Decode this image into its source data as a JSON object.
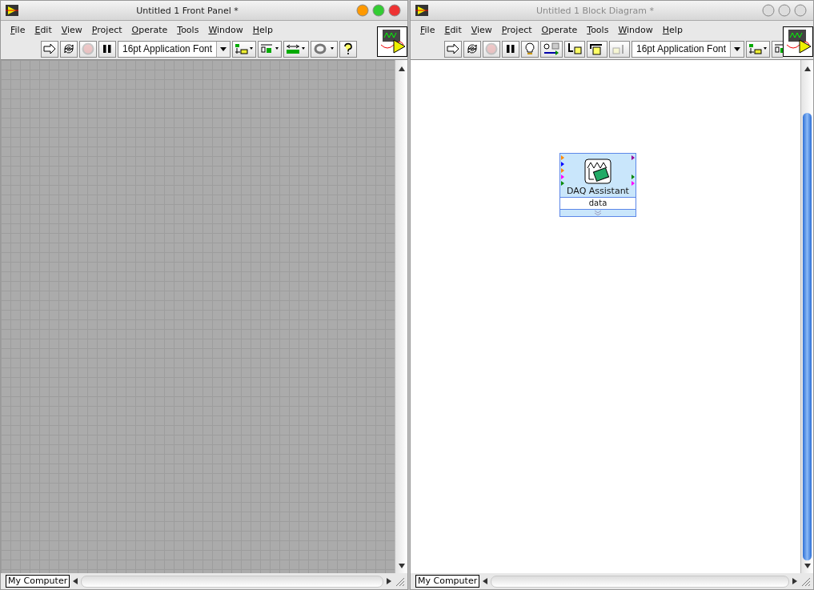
{
  "windows": [
    {
      "title": "Untitled 1 Front Panel *",
      "active": true,
      "menu": [
        "File",
        "Edit",
        "View",
        "Project",
        "Operate",
        "Tools",
        "Window",
        "Help"
      ],
      "toolbar": [
        {
          "kind": "run",
          "disabled": false
        },
        {
          "kind": "run-continuous",
          "disabled": false
        },
        {
          "kind": "abort",
          "disabled": true
        },
        {
          "kind": "pause",
          "disabled": false
        },
        {
          "kind": "font",
          "label": "16pt Application Font",
          "disabled": false
        },
        {
          "kind": "align",
          "disabled": false
        },
        {
          "kind": "distribute",
          "disabled": false
        },
        {
          "kind": "resize",
          "disabled": false
        },
        {
          "kind": "reorder",
          "disabled": false
        },
        {
          "kind": "help",
          "disabled": false
        }
      ],
      "canvas": {
        "kind": "grid",
        "scroll_thumb": false
      },
      "status_bar": {
        "target": "My Computer"
      }
    },
    {
      "title": "Untitled 1 Block Diagram *",
      "active": false,
      "menu": [
        "File",
        "Edit",
        "View",
        "Project",
        "Operate",
        "Tools",
        "Window",
        "Help"
      ],
      "toolbar": [
        {
          "kind": "run",
          "disabled": false
        },
        {
          "kind": "run-continuous",
          "disabled": false
        },
        {
          "kind": "abort",
          "disabled": true
        },
        {
          "kind": "pause",
          "disabled": false
        },
        {
          "kind": "highlight",
          "disabled": false
        },
        {
          "kind": "retain",
          "disabled": false
        },
        {
          "kind": "step-into",
          "disabled": false
        },
        {
          "kind": "step-over",
          "disabled": false
        },
        {
          "kind": "step-out",
          "disabled": true
        },
        {
          "kind": "font",
          "label": "16pt Application Font",
          "disabled": false
        },
        {
          "kind": "align",
          "disabled": false
        },
        {
          "kind": "distribute",
          "disabled": false
        }
      ],
      "canvas": {
        "kind": "plain",
        "scroll_thumb": true,
        "nodes": [
          {
            "title": "DAQ Assistant",
            "output": "data"
          }
        ]
      },
      "status_bar": {
        "target": "My Computer"
      }
    }
  ]
}
